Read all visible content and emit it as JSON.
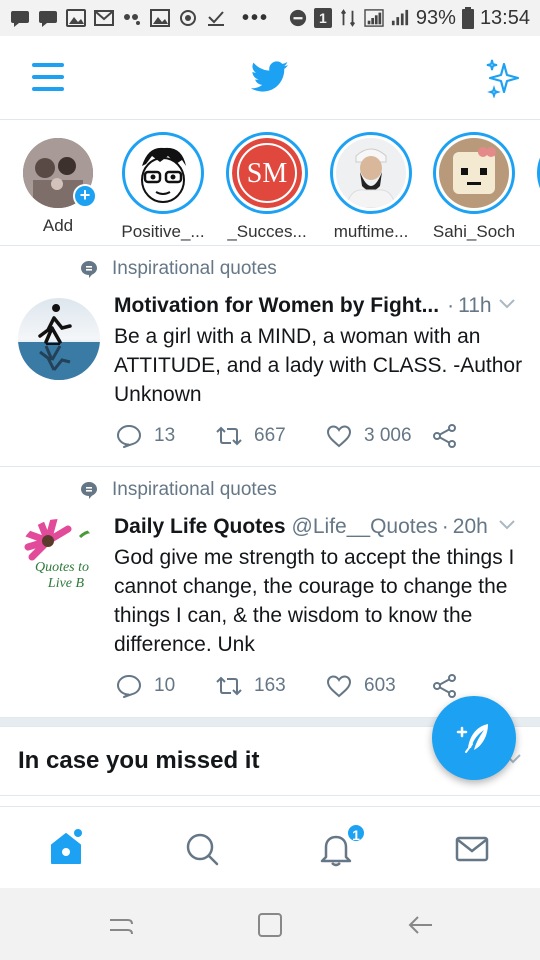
{
  "status_bar": {
    "battery": "93%",
    "time": "13:54",
    "sim_label": "1",
    "dots": "•••"
  },
  "top_nav": {
    "menu_icon": "hamburger-icon",
    "logo_icon": "twitter-bird-icon",
    "sparkle_icon": "sparkle-icon"
  },
  "fleets": [
    {
      "label": "Add"
    },
    {
      "label": "Positive_..."
    },
    {
      "label": "_Succes...",
      "initials": "SM"
    },
    {
      "label": "muftime..."
    },
    {
      "label": "Sahi_Soch"
    }
  ],
  "tweets": [
    {
      "context": "Inspirational quotes",
      "name": "Motivation for Women by Fight...",
      "handle": "",
      "dot": "·",
      "time": "11h",
      "text": "Be a girl with a MIND, a woman with an ATTITUDE, and a lady with CLASS. -Author Unknown",
      "replies": "13",
      "retweets": "667",
      "likes": "3 006"
    },
    {
      "context": "Inspirational quotes",
      "name": "Daily Life Quotes",
      "handle": "@Life__Quotes",
      "dot": "·",
      "time": "20h",
      "text": "God give me strength to accept the things I cannot change, the courage to change the things I can, & the wisdom to know the difference. Unk",
      "replies": "10",
      "retweets": "163",
      "likes": "603",
      "avatar_text_1": "Quotes to",
      "avatar_text_2": "Live B"
    }
  ],
  "icymi": {
    "title": "In case you missed it"
  },
  "bottom_nav": {
    "notification_badge": "1"
  },
  "colors": {
    "accent": "#1da1f2",
    "text": "#14171a",
    "secondary": "#657786",
    "border": "#e1e8ed"
  }
}
